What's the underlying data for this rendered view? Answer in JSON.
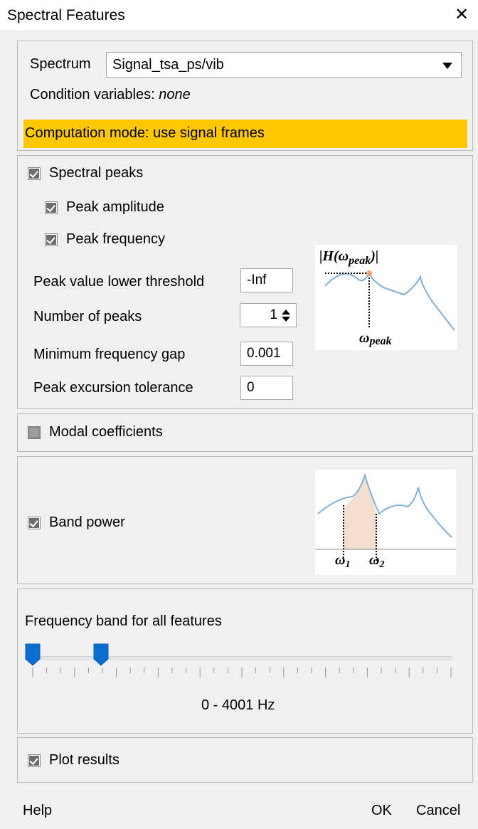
{
  "window": {
    "title": "Spectral Features"
  },
  "spectrum": {
    "label": "Spectrum",
    "selected": "Signal_tsa_ps/vib",
    "condition_label": "Condition variables:",
    "condition_value": "none",
    "mode_text": "Computation mode: use signal frames"
  },
  "spectral_peaks": {
    "label": "Spectral peaks",
    "checked": true,
    "peak_amplitude": {
      "label": "Peak amplitude",
      "checked": true
    },
    "peak_frequency": {
      "label": "Peak frequency",
      "checked": true
    },
    "threshold": {
      "label": "Peak value lower threshold",
      "value": "-Inf"
    },
    "num_peaks": {
      "label": "Number of peaks",
      "value": "1"
    },
    "min_gap": {
      "label": "Minimum frequency gap",
      "value": "0.001"
    },
    "excursion": {
      "label": "Peak excursion tolerance",
      "value": "0"
    },
    "diagram": {
      "top_text": "|H(ω",
      "top_sub": "peak",
      "top_close": ")|",
      "bottom_text": "ω",
      "bottom_sub": "peak"
    }
  },
  "modal": {
    "label": "Modal coefficients",
    "checked": false
  },
  "band_power": {
    "label": "Band power",
    "checked": true,
    "diagram": {
      "w1": "ω",
      "w1_sub": "1",
      "w2": "ω",
      "w2_sub": "2"
    }
  },
  "frequency_band": {
    "label": "Frequency band for all features",
    "range_text": "0 - 4001 Hz",
    "low_fraction": 0.0,
    "high_fraction": 0.162
  },
  "plot": {
    "label": "Plot results",
    "checked": true
  },
  "footer": {
    "help": "Help",
    "ok": "OK",
    "cancel": "Cancel"
  },
  "colors": {
    "warning": "#ffc800",
    "thumb": "#0a6ed1",
    "curve": "#7fb0d8",
    "band_fill": "#f5ddd0"
  }
}
